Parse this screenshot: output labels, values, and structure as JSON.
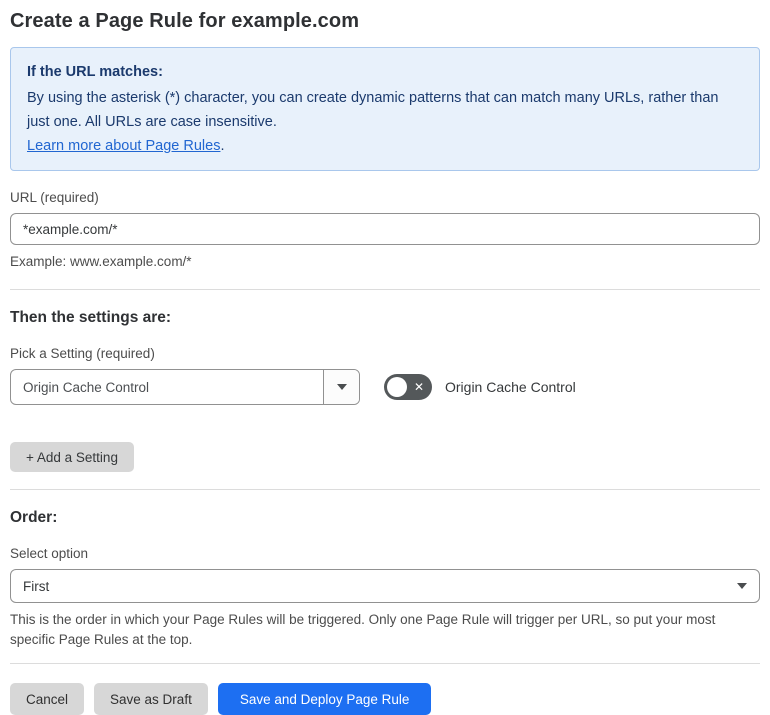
{
  "page": {
    "title": "Create a Page Rule for example.com"
  },
  "info_box": {
    "heading": "If the URL matches:",
    "body": "By using the asterisk (*) character, you can create dynamic patterns that can match many URLs, rather than just one. All URLs are case insensitive.",
    "link_label": "Learn more about Page Rules",
    "link_suffix": "."
  },
  "url_field": {
    "label": "URL (required)",
    "value": "*example.com/*",
    "helper": "Example: www.example.com/*"
  },
  "settings_section": {
    "heading": "Then the settings are:",
    "picker_label": "Pick a Setting (required)",
    "picker_value": "Origin Cache Control",
    "toggle_label": "Origin Cache Control",
    "toggle_state": "off",
    "toggle_off_glyph": "✕",
    "add_setting_label": "+ Add a Setting"
  },
  "order_section": {
    "heading": "Order:",
    "select_label": "Select option",
    "select_value": "First",
    "helper": "This is the order in which your Page Rules will be triggered. Only one Page Rule will trigger per URL, so put your most specific Page Rules at the top."
  },
  "footer": {
    "cancel_label": "Cancel",
    "save_draft_label": "Save as Draft",
    "save_deploy_label": "Save and Deploy Page Rule"
  },
  "colors": {
    "accent_blue": "#1d6ff2",
    "info_bg": "#e8f1fb",
    "info_border": "#a9c7ec",
    "info_text": "#1b3a6d",
    "link_blue": "#2166d1",
    "toggle_off_bg": "#54585a",
    "gray_button_bg": "#d7d7d7",
    "divider": "#dcdcdc"
  }
}
